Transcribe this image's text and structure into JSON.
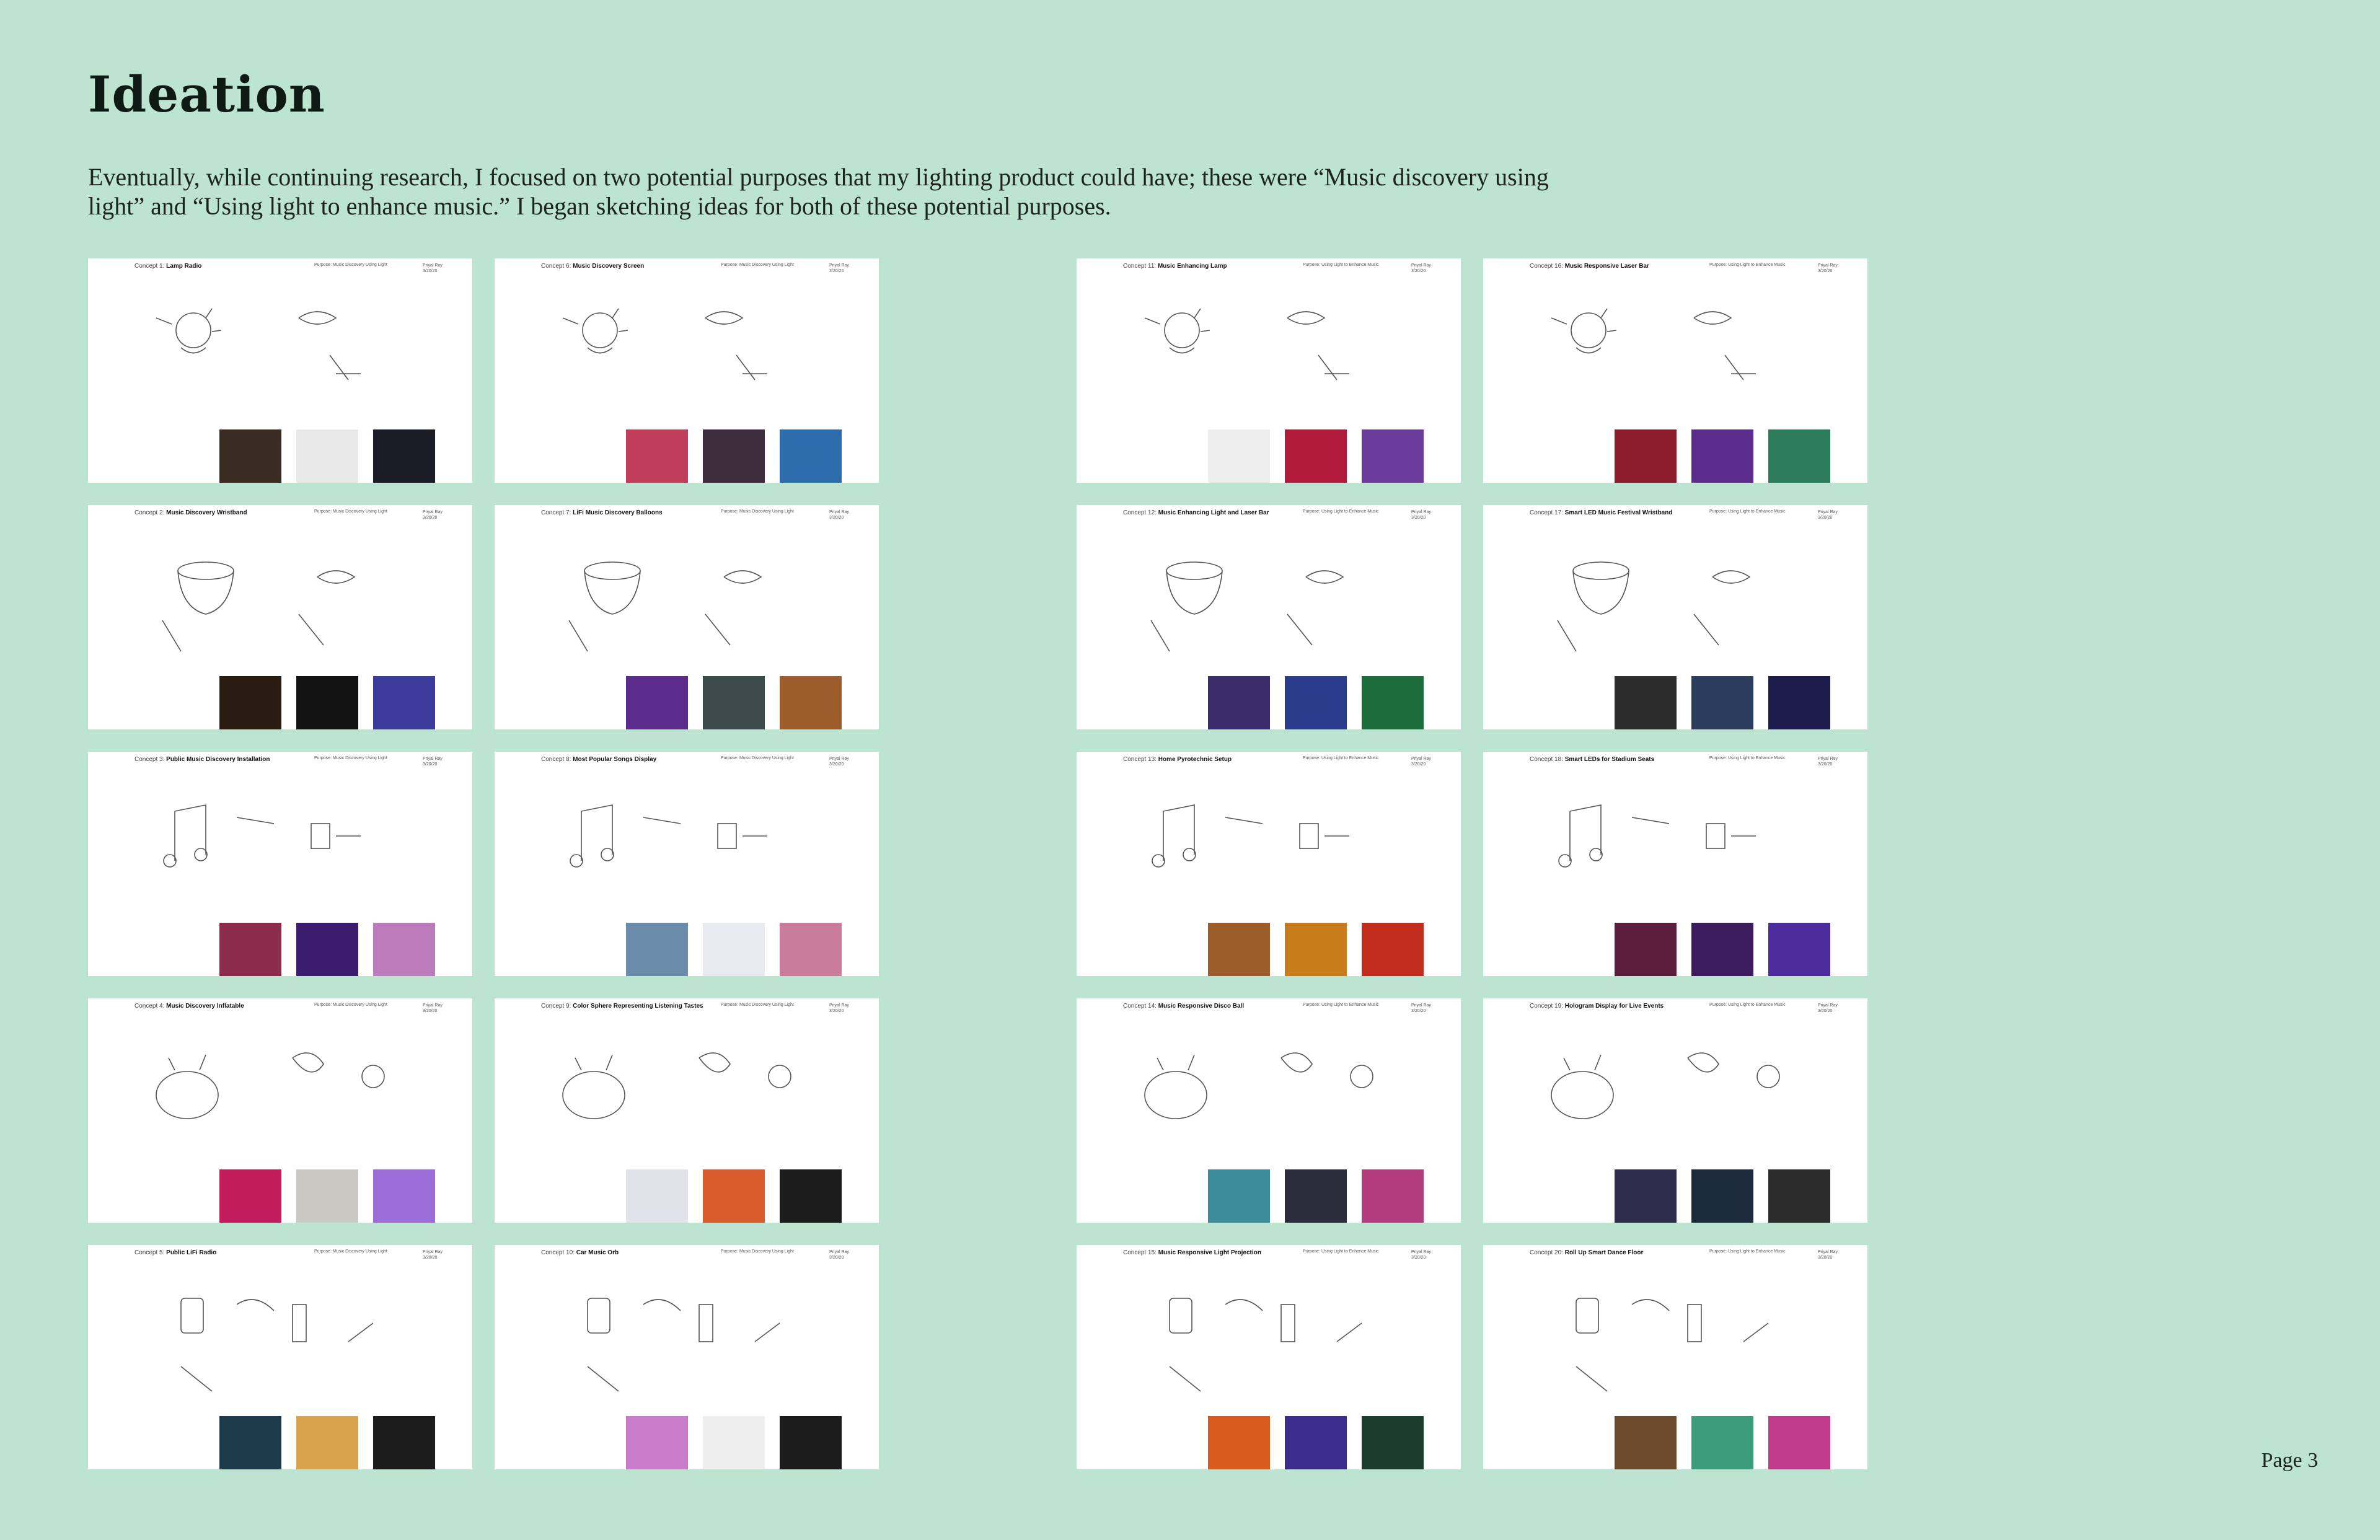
{
  "page": {
    "title": "Ideation",
    "intro": "Eventually, while continuing research, I focused on two potential purposes that my lighting product could have; these were “Music discovery using light” and “Using light to enhance music.” I began sketching ideas for both of these potential purposes.",
    "page_number": "Page 3"
  },
  "card_author": [
    "Priyal Ray",
    "3/20/20"
  ],
  "purposes": {
    "discovery": "Purpose: Music Discovery Using Light",
    "enhance": "Purpose: Using Light to Enhance Music"
  },
  "concepts": [
    {
      "num": "Concept 1:",
      "name": "Lamp Radio",
      "purpose": "discovery",
      "thumbs": [
        "#3a2c22",
        "#e9e9e9",
        "#1c1c26"
      ]
    },
    {
      "num": "Concept 2:",
      "name": "Music Discovery Wristband",
      "purpose": "discovery",
      "thumbs": [
        "#2b1c12",
        "#121212",
        "#3c3c9c"
      ]
    },
    {
      "num": "Concept 3:",
      "name": "Public Music Discovery Installation",
      "purpose": "discovery",
      "thumbs": [
        "#8c2c4c",
        "#3c1c6c",
        "#bc7cbc"
      ]
    },
    {
      "num": "Concept 4:",
      "name": "Music Discovery Inflatable",
      "purpose": "discovery",
      "thumbs": [
        "#c21c5c",
        "#c9c9c2",
        "#9c6cd9"
      ]
    },
    {
      "num": "Concept 5:",
      "name": "Public LiFi Radio",
      "purpose": "discovery",
      "thumbs": [
        "#1c3c4c",
        "#d9a24c",
        "#1c1c1c"
      ]
    },
    {
      "num": "Concept 6:",
      "name": "Music Discovery Screen",
      "purpose": "discovery",
      "thumbs": [
        "#c23c5c",
        "#3c2c3c",
        "#2c6cac"
      ]
    },
    {
      "num": "Concept 7:",
      "name": "LiFi Music Discovery Balloons",
      "purpose": "discovery",
      "thumbs": [
        "#5c2c8c",
        "#3c4c4c",
        "#9c5c2c"
      ]
    },
    {
      "num": "Concept 8:",
      "name": "Most Popular Songs Display",
      "purpose": "discovery",
      "thumbs": [
        "#6c8cac",
        "#e9e9f2",
        "#c97c9c"
      ]
    },
    {
      "num": "Concept 9:",
      "name": "Color Sphere Representing Listening Tastes",
      "purpose": "discovery",
      "thumbs": [
        "#e2e2ea",
        "#d95c2c",
        "#1c1c1c"
      ]
    },
    {
      "num": "Concept 10:",
      "name": "Car Music Orb",
      "purpose": "discovery",
      "thumbs": [
        "#c97cc9",
        "#eeeeee",
        "#1c1c1c"
      ]
    },
    {
      "num": "Concept 11:",
      "name": "Music Enhancing Lamp",
      "purpose": "enhance",
      "thumbs": [
        "#eeeeee",
        "#b21c3c",
        "#6c3c9c"
      ]
    },
    {
      "num": "Concept 12:",
      "name": "Music Enhancing Light and Laser Bar",
      "purpose": "enhance",
      "thumbs": [
        "#3c2c6c",
        "#2c3c8c",
        "#1c6c3c"
      ]
    },
    {
      "num": "Concept 13:",
      "name": "Home Pyrotechnic Setup",
      "purpose": "enhance",
      "thumbs": [
        "#9c5c2c",
        "#c97c1c",
        "#c22c1c"
      ]
    },
    {
      "num": "Concept 14:",
      "name": "Music Responsive Disco Ball",
      "purpose": "enhance",
      "thumbs": [
        "#3c8c9c",
        "#2c2c3c",
        "#b23c7c"
      ]
    },
    {
      "num": "Concept 15:",
      "name": "Music Responsive Light Projection",
      "purpose": "enhance",
      "thumbs": [
        "#d95c1c",
        "#3c2c8c",
        "#1c3c2c"
      ]
    },
    {
      "num": "Concept 16:",
      "name": "Music Responsive Laser Bar",
      "purpose": "enhance",
      "thumbs": [
        "#8c1c2c",
        "#5c2c8c",
        "#2c7c5c"
      ]
    },
    {
      "num": "Concept 17:",
      "name": "Smart LED Music Festival Wristband",
      "purpose": "enhance",
      "thumbs": [
        "#2c2c2c",
        "#2c3c5c",
        "#1c1c4c"
      ]
    },
    {
      "num": "Concept 18:",
      "name": "Smart LEDs for Stadium Seats",
      "purpose": "enhance",
      "thumbs": [
        "#5c1c3c",
        "#3c1c5c",
        "#4c2c9c"
      ]
    },
    {
      "num": "Concept 19:",
      "name": "Hologram Display for Live Events",
      "purpose": "enhance",
      "thumbs": [
        "#2c2c4c",
        "#1c2c3c",
        "#2c2c2c"
      ]
    },
    {
      "num": "Concept 20:",
      "name": "Roll Up Smart Dance Floor",
      "purpose": "enhance",
      "thumbs": [
        "#6c4c2c",
        "#3c9c7c",
        "#c23c8c"
      ]
    }
  ]
}
